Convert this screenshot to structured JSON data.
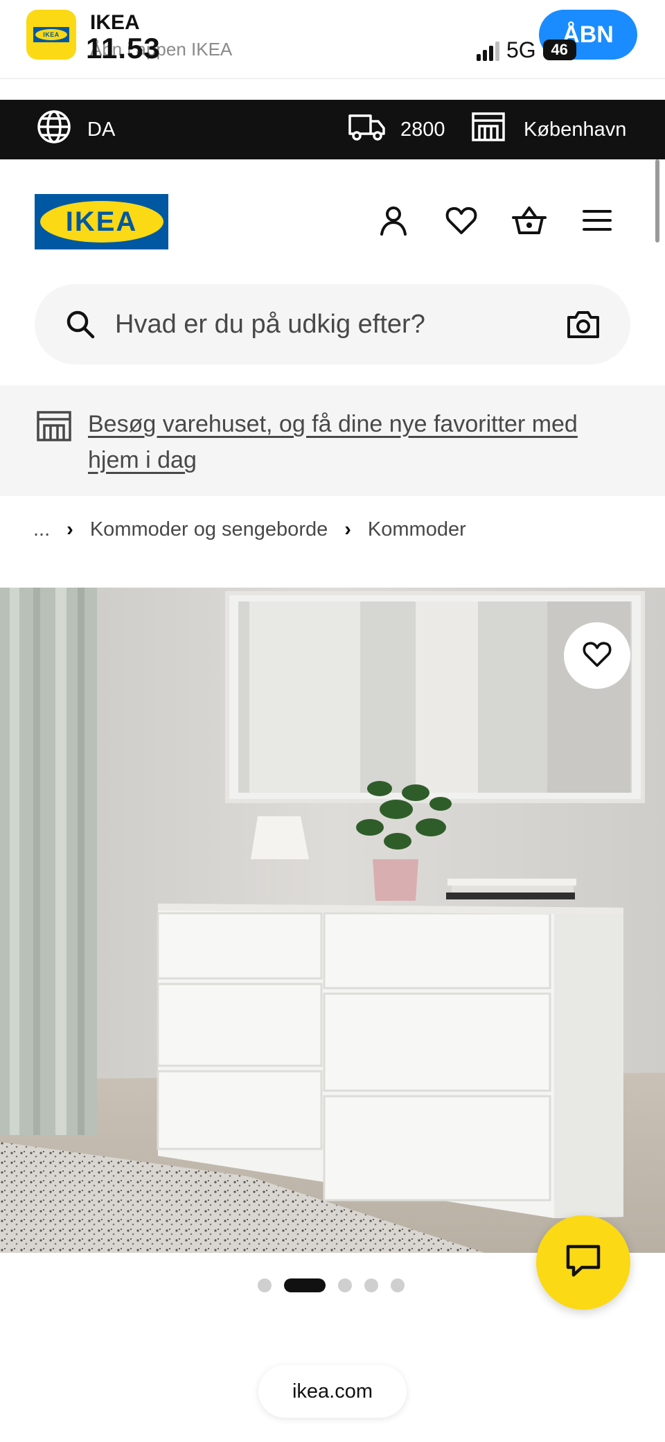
{
  "app_banner": {
    "app_name": "IKEA",
    "subtitle": "Åbn i appen IKEA",
    "open_label": "ÅBN",
    "logo_text": "IKEA"
  },
  "status_bar": {
    "time": "11.53",
    "network": "5G",
    "battery": "46"
  },
  "topbar": {
    "language": "DA",
    "postal_code": "2800",
    "store": "København"
  },
  "header": {
    "logo_text": "IKEA"
  },
  "search": {
    "placeholder": "Hvad er du på udkig efter?"
  },
  "promo": {
    "text": "Besøg varehuset, og få dine nye favoritter med hjem i dag"
  },
  "breadcrumb": {
    "ellipsis": "...",
    "items": [
      "Kommoder og sengeborde",
      "Kommoder"
    ]
  },
  "carousel": {
    "total": 5,
    "active_index": 1
  },
  "browser": {
    "url": "ikea.com"
  },
  "colors": {
    "brand_blue": "#0058A3",
    "brand_yellow": "#FBD914",
    "topbar_bg": "#111111",
    "ios_blue": "#1a8cff"
  }
}
